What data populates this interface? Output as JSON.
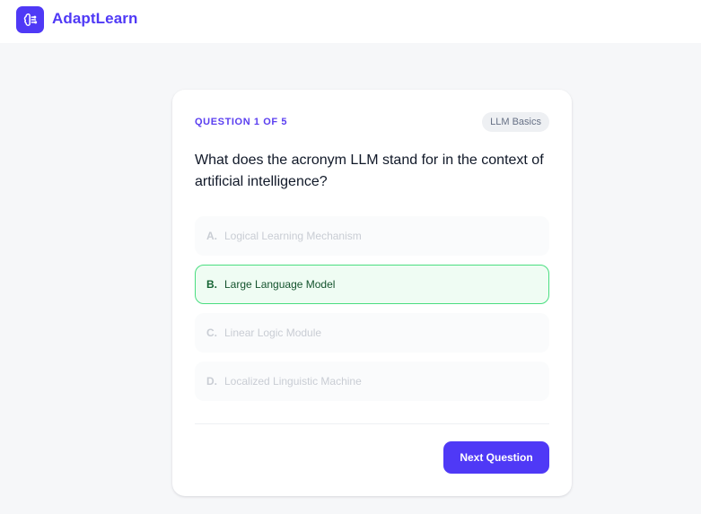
{
  "brand": {
    "name": "AdaptLearn",
    "logo_icon": "brain-icon",
    "accent_color": "#4f39f6"
  },
  "quiz": {
    "counter": "QUESTION 1 OF 5",
    "topic": "LLM Basics",
    "question": "What does the acronym LLM stand for in the context of artificial intelligence?",
    "options": [
      {
        "letter": "A.",
        "text": "Logical Learning Mechanism",
        "state": "dimmed"
      },
      {
        "letter": "B.",
        "text": "Large Language Model",
        "state": "selected"
      },
      {
        "letter": "C.",
        "text": "Linear Logic Module",
        "state": "dimmed"
      },
      {
        "letter": "D.",
        "text": "Localized Linguistic Machine",
        "state": "dimmed"
      }
    ],
    "selected_color": "#4ade80",
    "next_label": "Next Question"
  }
}
